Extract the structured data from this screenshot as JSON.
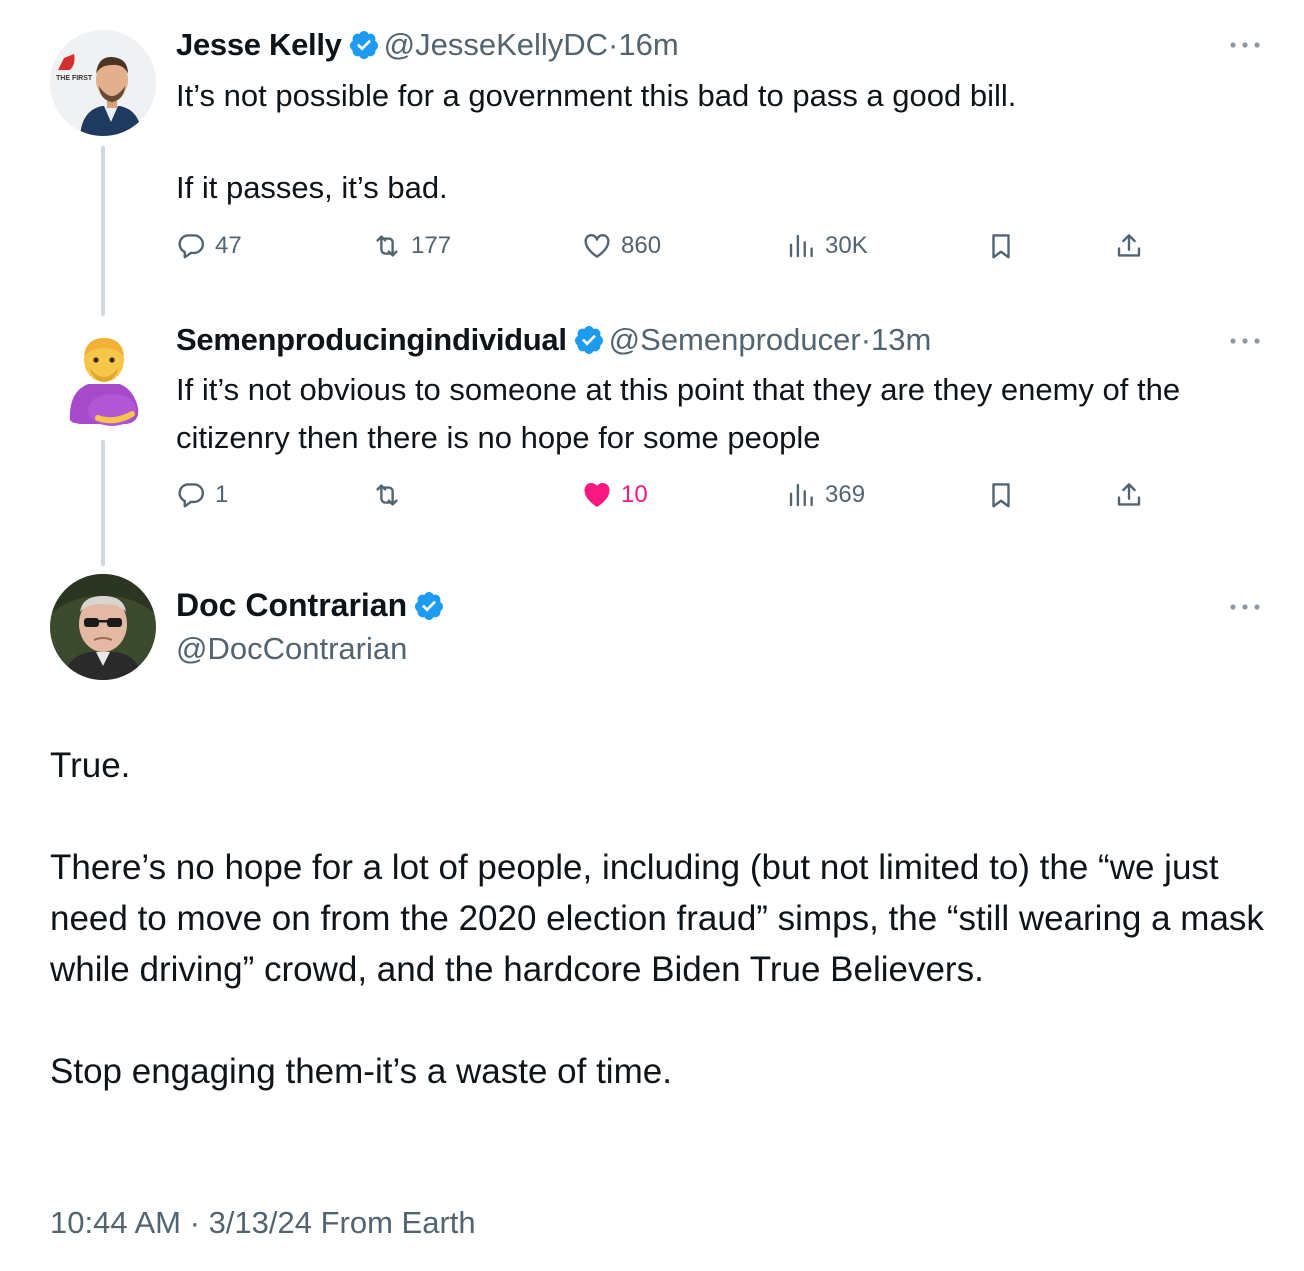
{
  "colors": {
    "text": "#0f1419",
    "secondary": "#536471",
    "verified_blue": "#1d9bf0",
    "like_pink": "#f91880",
    "thread_line": "#cfd9de"
  },
  "tweets": [
    {
      "name": "Jesse Kelly",
      "handle": "@JesseKellyDC",
      "separator": "·",
      "time": "16m",
      "avatar_badge": "THE FIRST",
      "text": [
        "It’s not possible for a government this bad to pass a good bill.",
        "",
        "If it passes, it’s bad."
      ],
      "replies": "47",
      "retweets": "177",
      "likes": "860",
      "views": "30K",
      "liked": false
    },
    {
      "name": "Semenproducingindividual",
      "handle": "@Semenproducer",
      "separator": "·",
      "time": "13m",
      "avatar_icon": "pregnant-man-emoji",
      "text": [
        "If it’s not obvious to someone at this point that they are they enemy of the citizenry then there is no hope for some people"
      ],
      "replies": "1",
      "retweets": "",
      "likes": "10",
      "views": "369",
      "liked": true
    }
  ],
  "main_tweet": {
    "name": "Doc Contrarian",
    "handle": "@DocContrarian",
    "paragraphs": [
      "True.",
      "There’s no hope for a lot of people, including (but not limited to) the “we just need to move on from the 2020 election fraud” simps, the “still wearing a mask while driving” crowd, and the hardcore Biden True Believers.",
      "Stop engaging them-it’s a waste of time."
    ],
    "time": "10:44 AM",
    "separator": "·",
    "date": "3/13/24",
    "source": "From Earth"
  },
  "icons": [
    "reply-icon",
    "retweet-icon",
    "like-icon",
    "views-icon",
    "bookmark-icon",
    "share-icon",
    "verified-badge-icon",
    "more-options-icon"
  ]
}
